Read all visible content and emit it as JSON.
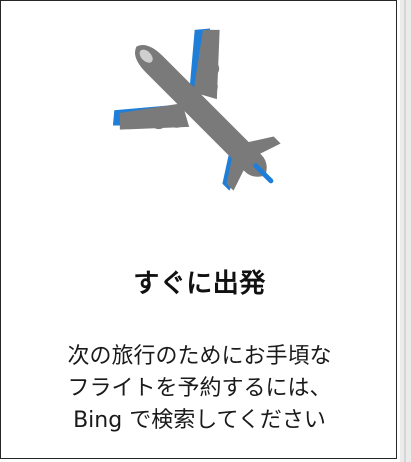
{
  "card": {
    "title": "すぐに出発",
    "description_lines": [
      "次の旅行のためにお手頃な",
      "フライトを予約するには、",
      "Bing で検索してください"
    ]
  },
  "illustration": {
    "icon": "airplane-icon",
    "colors": {
      "body": "#7a7a7a",
      "accent": "#1f7fd8",
      "window": "#cfcfcf"
    }
  }
}
